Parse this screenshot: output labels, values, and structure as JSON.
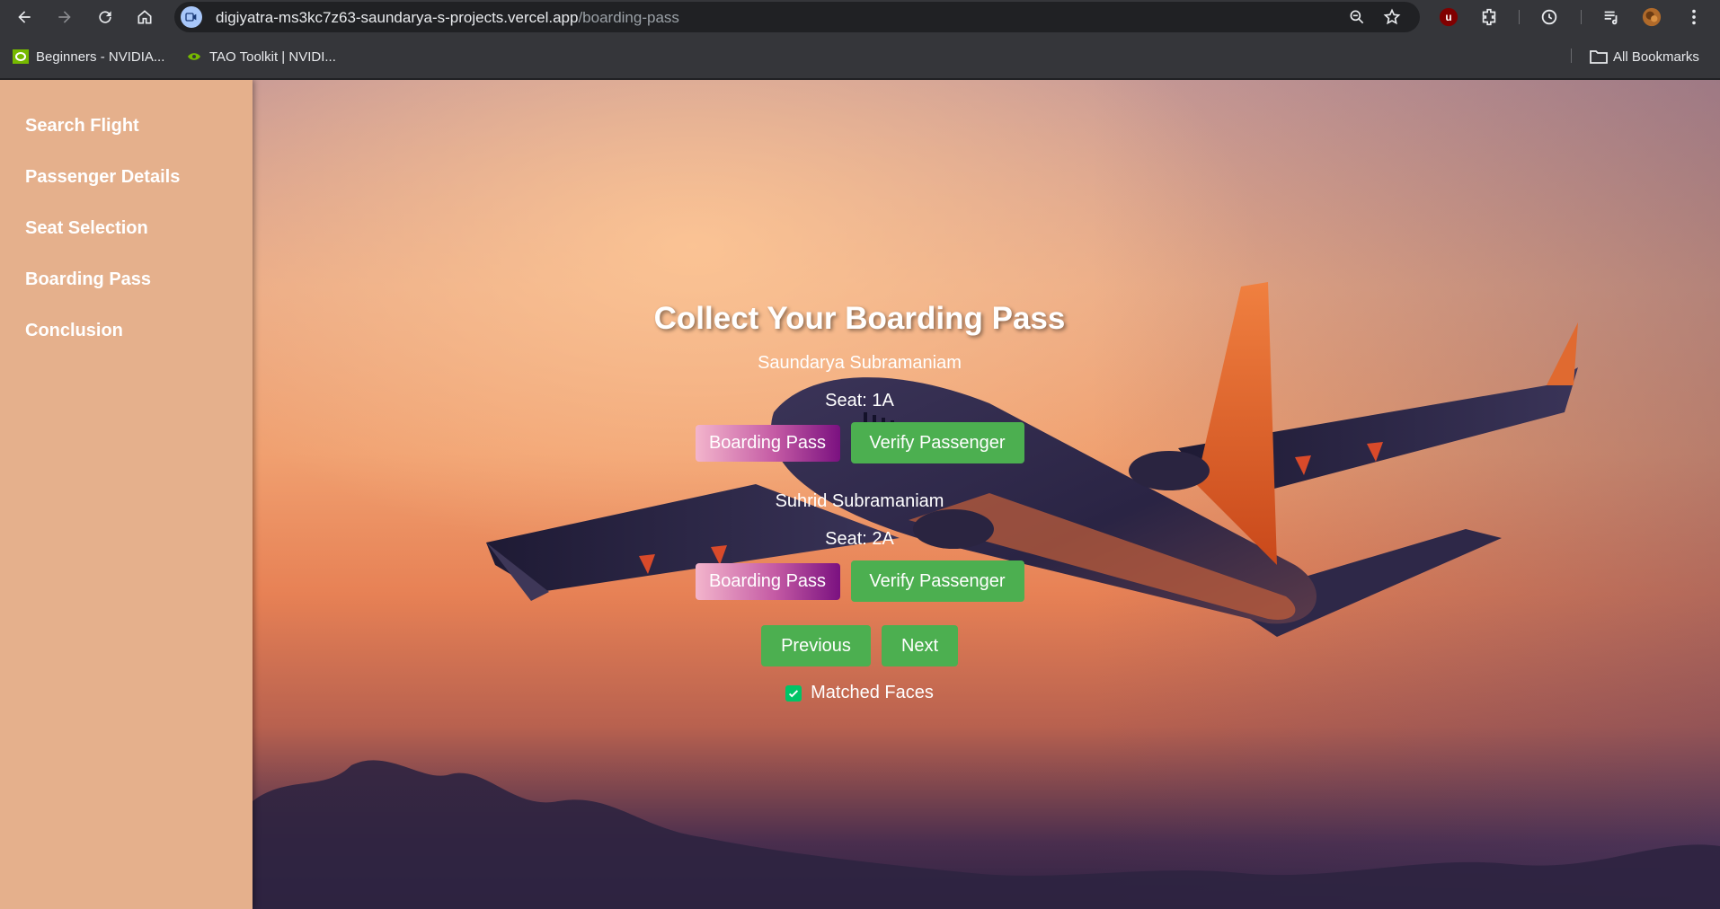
{
  "browser": {
    "url_domain": "digiyatra-ms3kc7z63-saundarya-s-projects.vercel.app",
    "url_path": "/boarding-pass",
    "bookmarks": [
      {
        "label": "Beginners - NVIDIA..."
      },
      {
        "label": "TAO Toolkit | NVIDI..."
      }
    ],
    "all_bookmarks_label": "All Bookmarks",
    "extension_badge": "u"
  },
  "sidebar": {
    "items": [
      {
        "label": "Search Flight"
      },
      {
        "label": "Passenger Details"
      },
      {
        "label": "Seat Selection"
      },
      {
        "label": "Boarding Pass"
      },
      {
        "label": "Conclusion"
      }
    ]
  },
  "main": {
    "title": "Collect Your Boarding Pass",
    "passengers": [
      {
        "name": "Saundarya Subramaniam",
        "seat": "Seat: 1A",
        "boarding_pass_label": "Boarding Pass",
        "verify_label": "Verify Passenger"
      },
      {
        "name": "Suhrid Subramaniam",
        "seat": "Seat: 2A",
        "boarding_pass_label": "Boarding Pass",
        "verify_label": "Verify Passenger"
      }
    ],
    "previous_label": "Previous",
    "next_label": "Next",
    "matched_faces_label": "Matched Faces",
    "matched_faces_checked": true
  },
  "colors": {
    "sidebar_bg": "#e5b08c",
    "green_button": "#4caf50",
    "checkbox": "#00c467"
  }
}
